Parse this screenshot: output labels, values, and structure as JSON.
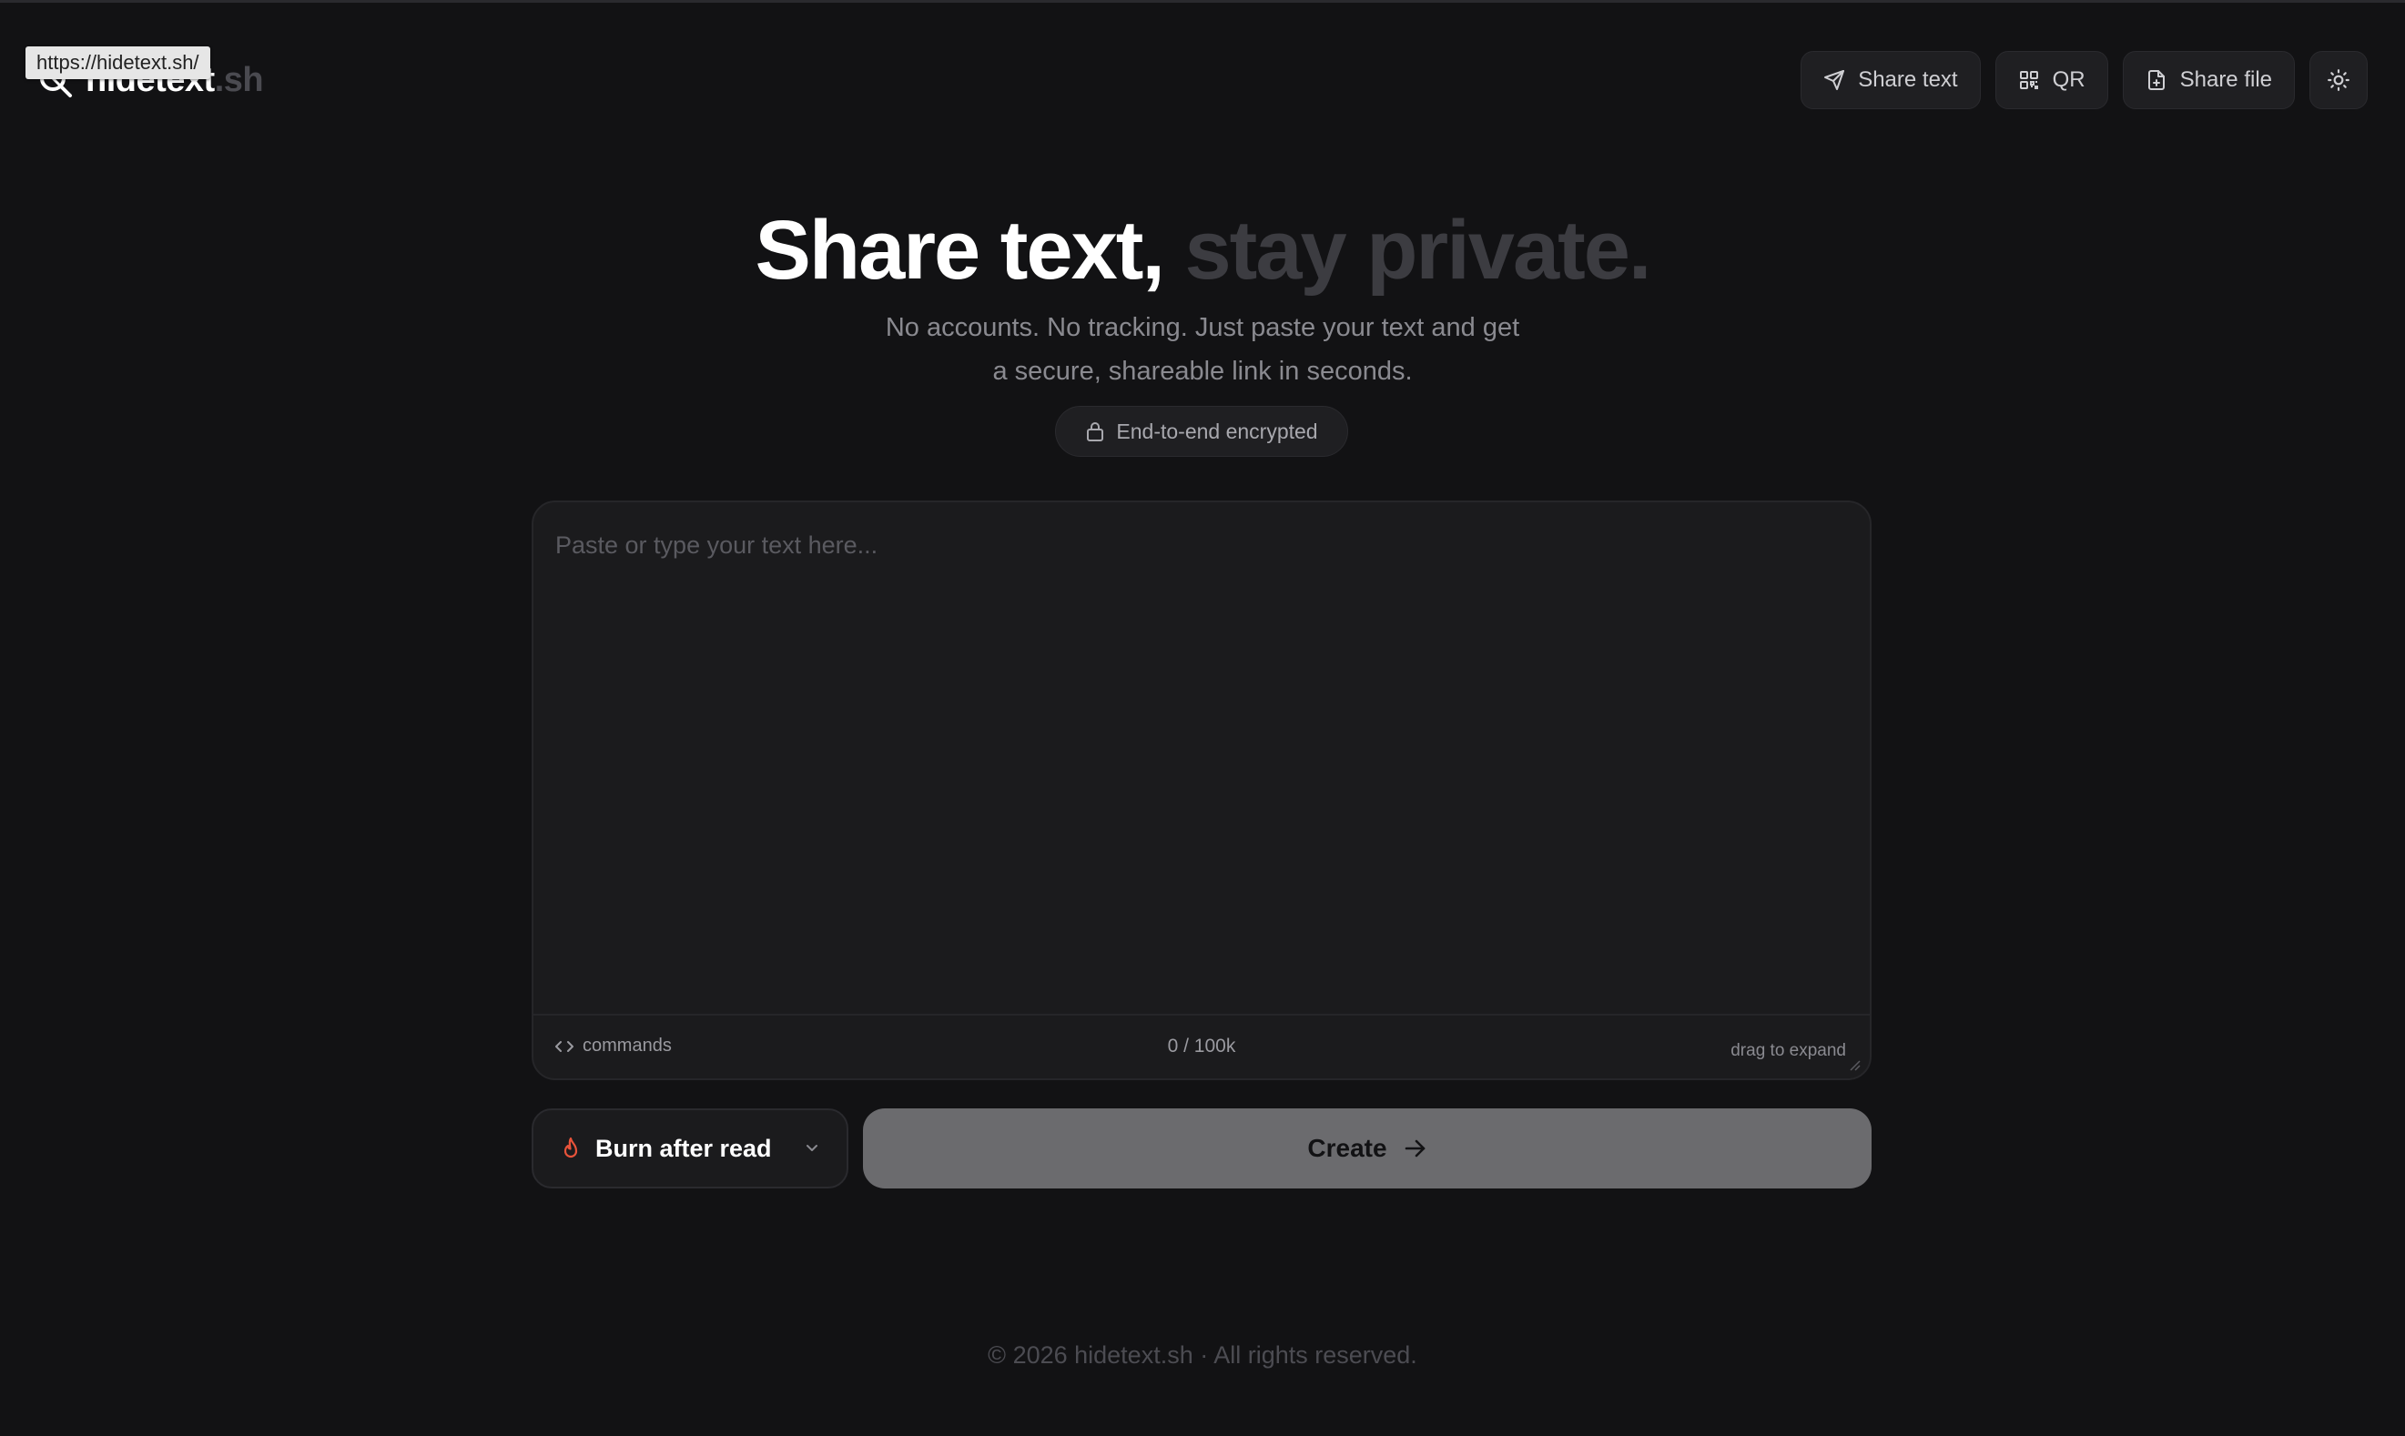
{
  "browser": {
    "status_url": "https://hidetext.sh/"
  },
  "logo": {
    "name": "hidetext",
    "tld": ".sh"
  },
  "nav": {
    "items": [
      {
        "label": "Share text",
        "icon": "send-icon"
      },
      {
        "label": "QR",
        "icon": "qr-code-icon"
      },
      {
        "label": "Share file",
        "icon": "file-upload-icon"
      }
    ],
    "theme_toggle_icon": "sun-icon"
  },
  "hero": {
    "title_main": "Share text,",
    "title_muted": "stay private.",
    "subtitle_line1": "No accounts. No tracking. Just paste your text and get",
    "subtitle_line2": "a secure, shareable link in seconds.",
    "badge": "End-to-end encrypted",
    "badge_icon": "lock-icon"
  },
  "editor": {
    "placeholder": "Paste or type your text here...",
    "value": "",
    "commands_label": "commands",
    "counter": "0 / 100k",
    "drag_hint": "drag to expand"
  },
  "controls": {
    "expiry_label": "Burn after read",
    "expiry_icon": "flame-icon",
    "create_label": "Create"
  },
  "footer": {
    "text": "© 2026 hidetext.sh · All rights reserved."
  },
  "colors": {
    "background": "#121214",
    "surface": "#1b1b1d",
    "accent_flame": "#e8533a",
    "create_button": "#6b6b6e",
    "muted_text": "#8a8a90"
  }
}
